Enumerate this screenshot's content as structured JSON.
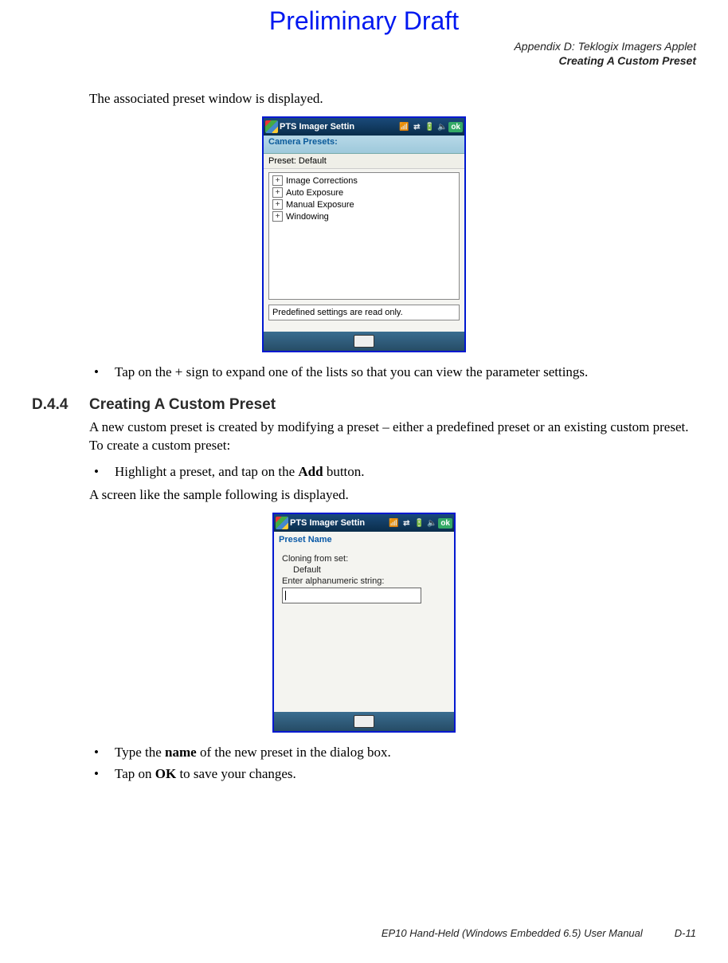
{
  "watermark": "Preliminary Draft",
  "header": {
    "line1": "Appendix D:  Teklogix Imagers Applet",
    "line2": "Creating A Custom Preset"
  },
  "intro_para": "The associated preset window is displayed.",
  "screenshot1": {
    "title": "PTS Imager Settin",
    "ok_label": "ok",
    "tab_label": "Camera Presets:",
    "preset_row": "Preset:  Default",
    "tree_items": [
      "Image Corrections",
      "Auto Exposure",
      "Manual Exposure",
      "Windowing"
    ],
    "plus_glyph": "+",
    "hint": "Predefined settings are read only.",
    "icons": {
      "flag": "windows-flag-icon",
      "signal": "signal-icon",
      "network": "network-icon",
      "battery": "battery-icon",
      "volume": "volume-icon",
      "keyboard": "keyboard-icon"
    }
  },
  "bullet_after_ss1": "Tap on the + sign to expand one of the lists so that you can view the parameter settings.",
  "section": {
    "number": "D.4.4",
    "title": "Creating A Custom Preset"
  },
  "para_after_section": "A new custom preset is created by modifying a preset – either a predefined preset or an existing custom preset. To create a custom preset:",
  "bullet2_pre": "Highlight a preset, and tap on the ",
  "bullet2_bold": "Add",
  "bullet2_post": " button.",
  "para_before_ss2": "A screen like the sample following is displayed.",
  "screenshot2": {
    "title": "PTS Imager Settin",
    "ok_label": "ok",
    "tab_label": "Preset Name",
    "line1": "Cloning from set:",
    "line2": "Default",
    "line3": "Enter alphanumeric string:",
    "input_value": ""
  },
  "bullets_after_ss2": [
    {
      "pre": "Type the ",
      "bold": "name",
      "post": " of the new preset in the dialog box."
    },
    {
      "pre": "Tap on ",
      "bold": "OK",
      "post": " to save your changes."
    }
  ],
  "footer": {
    "manual": "EP10 Hand-Held (Windows Embedded 6.5) User Manual",
    "page": "D-11"
  },
  "bullet_glyph": "•"
}
